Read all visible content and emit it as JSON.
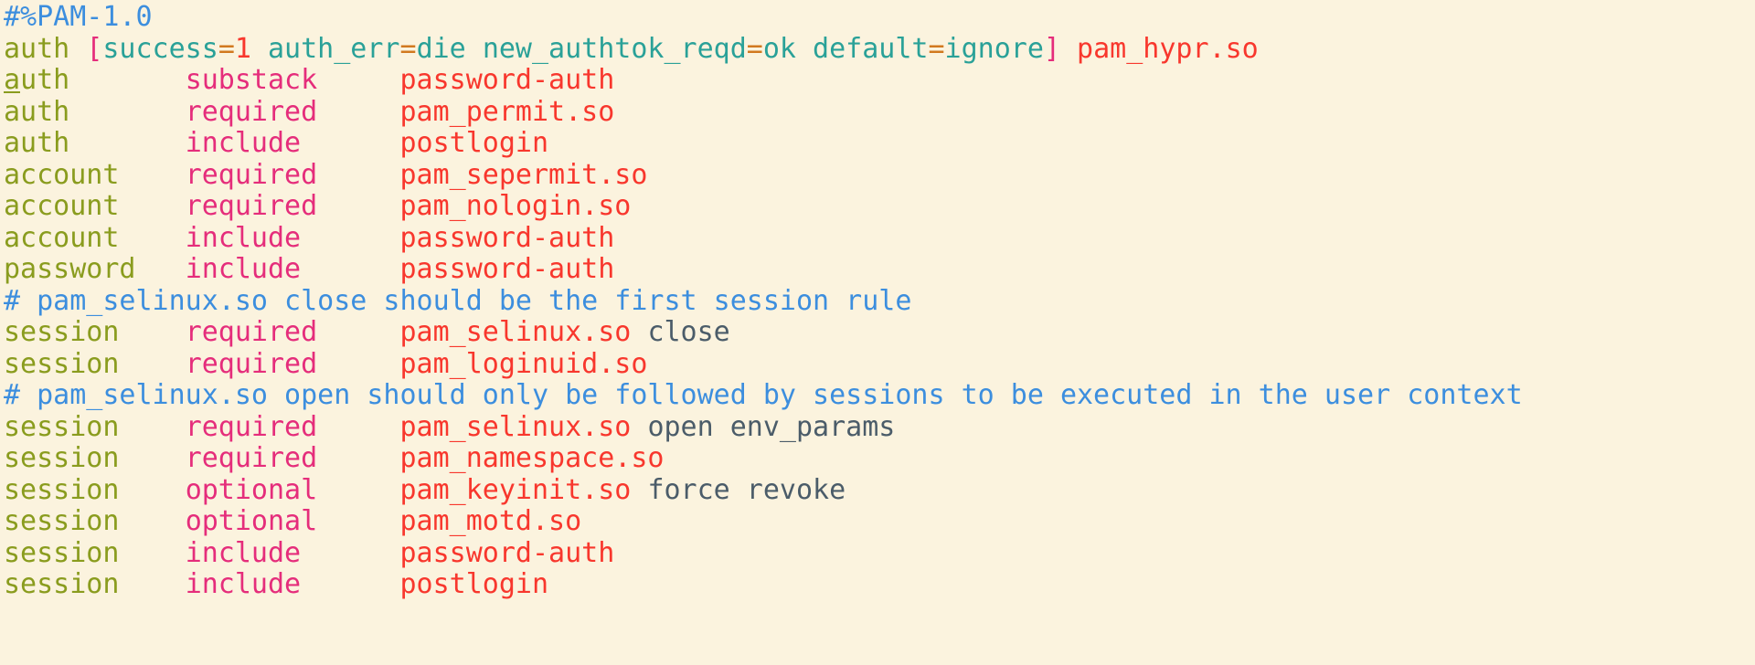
{
  "editor": {
    "background_color": "#fbf3de",
    "file_type": "pam-config",
    "colors": {
      "comment": "#3c8ede",
      "type": "#8a9c1e",
      "flag": "#e52d7b",
      "module": "#f8372d",
      "bracket": "#e52d7b",
      "key": "#2aa198",
      "equals": "#d1791f",
      "number": "#f8372d",
      "argument": "#4b5c69"
    },
    "cursor": {
      "line": 3,
      "column": 1,
      "style": "underline"
    }
  },
  "lines": [
    {
      "n": 1,
      "tokens": [
        {
          "text": "#%PAM-1.0",
          "cls": "t-comment"
        }
      ]
    },
    {
      "n": 2,
      "tokens": [
        {
          "text": "auth",
          "cls": "t-type"
        },
        {
          "text": " ",
          "cls": "t-plain"
        },
        {
          "text": "[",
          "cls": "t-bracket"
        },
        {
          "text": "success",
          "cls": "t-key"
        },
        {
          "text": "=",
          "cls": "t-eq"
        },
        {
          "text": "1",
          "cls": "t-num"
        },
        {
          "text": " ",
          "cls": "t-plain"
        },
        {
          "text": "auth_err",
          "cls": "t-key"
        },
        {
          "text": "=",
          "cls": "t-eq"
        },
        {
          "text": "die",
          "cls": "t-key"
        },
        {
          "text": " ",
          "cls": "t-plain"
        },
        {
          "text": "new_authtok_reqd",
          "cls": "t-key"
        },
        {
          "text": "=",
          "cls": "t-eq"
        },
        {
          "text": "ok",
          "cls": "t-key"
        },
        {
          "text": " ",
          "cls": "t-plain"
        },
        {
          "text": "default",
          "cls": "t-key"
        },
        {
          "text": "=",
          "cls": "t-eq"
        },
        {
          "text": "ignore",
          "cls": "t-key"
        },
        {
          "text": "]",
          "cls": "t-bracket"
        },
        {
          "text": " ",
          "cls": "t-plain"
        },
        {
          "text": "pam_hypr.so",
          "cls": "t-module"
        }
      ]
    },
    {
      "n": 3,
      "tokens": [
        {
          "text": "auth",
          "cls": "t-type"
        },
        {
          "text": "       ",
          "cls": "t-plain"
        },
        {
          "text": "substack",
          "cls": "t-flag"
        },
        {
          "text": "     ",
          "cls": "t-plain"
        },
        {
          "text": "password-auth",
          "cls": "t-module"
        }
      ]
    },
    {
      "n": 4,
      "tokens": [
        {
          "text": "auth",
          "cls": "t-type"
        },
        {
          "text": "       ",
          "cls": "t-plain"
        },
        {
          "text": "required",
          "cls": "t-flag"
        },
        {
          "text": "     ",
          "cls": "t-plain"
        },
        {
          "text": "pam_permit.so",
          "cls": "t-module"
        }
      ]
    },
    {
      "n": 5,
      "tokens": [
        {
          "text": "auth",
          "cls": "t-type"
        },
        {
          "text": "       ",
          "cls": "t-plain"
        },
        {
          "text": "include",
          "cls": "t-flag"
        },
        {
          "text": "      ",
          "cls": "t-plain"
        },
        {
          "text": "postlogin",
          "cls": "t-module"
        }
      ]
    },
    {
      "n": 6,
      "tokens": [
        {
          "text": "account",
          "cls": "t-type"
        },
        {
          "text": "    ",
          "cls": "t-plain"
        },
        {
          "text": "required",
          "cls": "t-flag"
        },
        {
          "text": "     ",
          "cls": "t-plain"
        },
        {
          "text": "pam_sepermit.so",
          "cls": "t-module"
        }
      ]
    },
    {
      "n": 7,
      "tokens": [
        {
          "text": "account",
          "cls": "t-type"
        },
        {
          "text": "    ",
          "cls": "t-plain"
        },
        {
          "text": "required",
          "cls": "t-flag"
        },
        {
          "text": "     ",
          "cls": "t-plain"
        },
        {
          "text": "pam_nologin.so",
          "cls": "t-module"
        }
      ]
    },
    {
      "n": 8,
      "tokens": [
        {
          "text": "account",
          "cls": "t-type"
        },
        {
          "text": "    ",
          "cls": "t-plain"
        },
        {
          "text": "include",
          "cls": "t-flag"
        },
        {
          "text": "      ",
          "cls": "t-plain"
        },
        {
          "text": "password-auth",
          "cls": "t-module"
        }
      ]
    },
    {
      "n": 9,
      "tokens": [
        {
          "text": "password",
          "cls": "t-type"
        },
        {
          "text": "   ",
          "cls": "t-plain"
        },
        {
          "text": "include",
          "cls": "t-flag"
        },
        {
          "text": "      ",
          "cls": "t-plain"
        },
        {
          "text": "password-auth",
          "cls": "t-module"
        }
      ]
    },
    {
      "n": 10,
      "tokens": [
        {
          "text": "# pam_selinux.so close should be the first session rule",
          "cls": "t-comment"
        }
      ]
    },
    {
      "n": 11,
      "tokens": [
        {
          "text": "session",
          "cls": "t-type"
        },
        {
          "text": "    ",
          "cls": "t-plain"
        },
        {
          "text": "required",
          "cls": "t-flag"
        },
        {
          "text": "     ",
          "cls": "t-plain"
        },
        {
          "text": "pam_selinux.so",
          "cls": "t-module"
        },
        {
          "text": " ",
          "cls": "t-plain"
        },
        {
          "text": "close",
          "cls": "t-arg"
        }
      ]
    },
    {
      "n": 12,
      "tokens": [
        {
          "text": "session",
          "cls": "t-type"
        },
        {
          "text": "    ",
          "cls": "t-plain"
        },
        {
          "text": "required",
          "cls": "t-flag"
        },
        {
          "text": "     ",
          "cls": "t-plain"
        },
        {
          "text": "pam_loginuid.so",
          "cls": "t-module"
        }
      ]
    },
    {
      "n": 13,
      "tokens": [
        {
          "text": "# pam_selinux.so open should only be followed by sessions to be executed in the user context",
          "cls": "t-comment"
        }
      ]
    },
    {
      "n": 14,
      "tokens": [
        {
          "text": "session",
          "cls": "t-type"
        },
        {
          "text": "    ",
          "cls": "t-plain"
        },
        {
          "text": "required",
          "cls": "t-flag"
        },
        {
          "text": "     ",
          "cls": "t-plain"
        },
        {
          "text": "pam_selinux.so",
          "cls": "t-module"
        },
        {
          "text": " ",
          "cls": "t-plain"
        },
        {
          "text": "open env_params",
          "cls": "t-arg"
        }
      ]
    },
    {
      "n": 15,
      "tokens": [
        {
          "text": "session",
          "cls": "t-type"
        },
        {
          "text": "    ",
          "cls": "t-plain"
        },
        {
          "text": "required",
          "cls": "t-flag"
        },
        {
          "text": "     ",
          "cls": "t-plain"
        },
        {
          "text": "pam_namespace.so",
          "cls": "t-module"
        }
      ]
    },
    {
      "n": 16,
      "tokens": [
        {
          "text": "session",
          "cls": "t-type"
        },
        {
          "text": "    ",
          "cls": "t-plain"
        },
        {
          "text": "optional",
          "cls": "t-flag"
        },
        {
          "text": "     ",
          "cls": "t-plain"
        },
        {
          "text": "pam_keyinit.so",
          "cls": "t-module"
        },
        {
          "text": " ",
          "cls": "t-plain"
        },
        {
          "text": "force revoke",
          "cls": "t-arg"
        }
      ]
    },
    {
      "n": 17,
      "tokens": [
        {
          "text": "session",
          "cls": "t-type"
        },
        {
          "text": "    ",
          "cls": "t-plain"
        },
        {
          "text": "optional",
          "cls": "t-flag"
        },
        {
          "text": "     ",
          "cls": "t-plain"
        },
        {
          "text": "pam_motd.so",
          "cls": "t-module"
        }
      ]
    },
    {
      "n": 18,
      "tokens": [
        {
          "text": "session",
          "cls": "t-type"
        },
        {
          "text": "    ",
          "cls": "t-plain"
        },
        {
          "text": "include",
          "cls": "t-flag"
        },
        {
          "text": "      ",
          "cls": "t-plain"
        },
        {
          "text": "password-auth",
          "cls": "t-module"
        }
      ]
    },
    {
      "n": 19,
      "tokens": [
        {
          "text": "session",
          "cls": "t-type"
        },
        {
          "text": "    ",
          "cls": "t-plain"
        },
        {
          "text": "include",
          "cls": "t-flag"
        },
        {
          "text": "      ",
          "cls": "t-plain"
        },
        {
          "text": "postlogin",
          "cls": "t-module"
        }
      ]
    }
  ]
}
